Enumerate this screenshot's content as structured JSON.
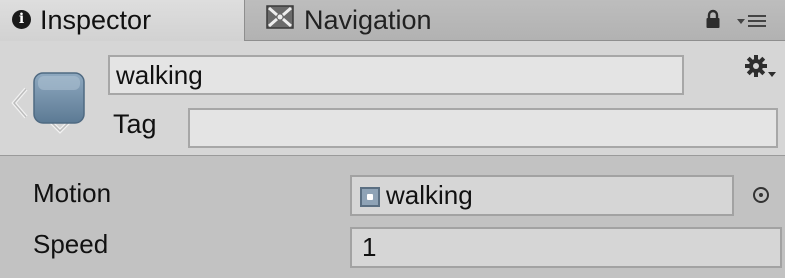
{
  "tabs": {
    "inspector": {
      "label": "Inspector",
      "icon": "info-icon",
      "active": true
    },
    "navigation": {
      "label": "Navigation",
      "icon": "navigation-icon",
      "active": false
    }
  },
  "tab_bar_icons": [
    "lock-icon",
    "tab-menu-icon"
  ],
  "header": {
    "object_icon": "gameobject-icon",
    "name_value": "walking",
    "tag_label": "Tag",
    "tag_value": "",
    "settings_icon": "gear-icon"
  },
  "properties": {
    "motion": {
      "label": "Motion",
      "value": "walking",
      "value_icon": "animation-clip-icon",
      "picker_icon": "object-picker-icon"
    },
    "speed": {
      "label": "Speed",
      "value": "1"
    }
  },
  "colors": {
    "panel_background": "#c2c2c2",
    "header_background": "#d6d6d6",
    "active_tab": "#d8d8d8",
    "field_background": "#e4e4e4"
  }
}
